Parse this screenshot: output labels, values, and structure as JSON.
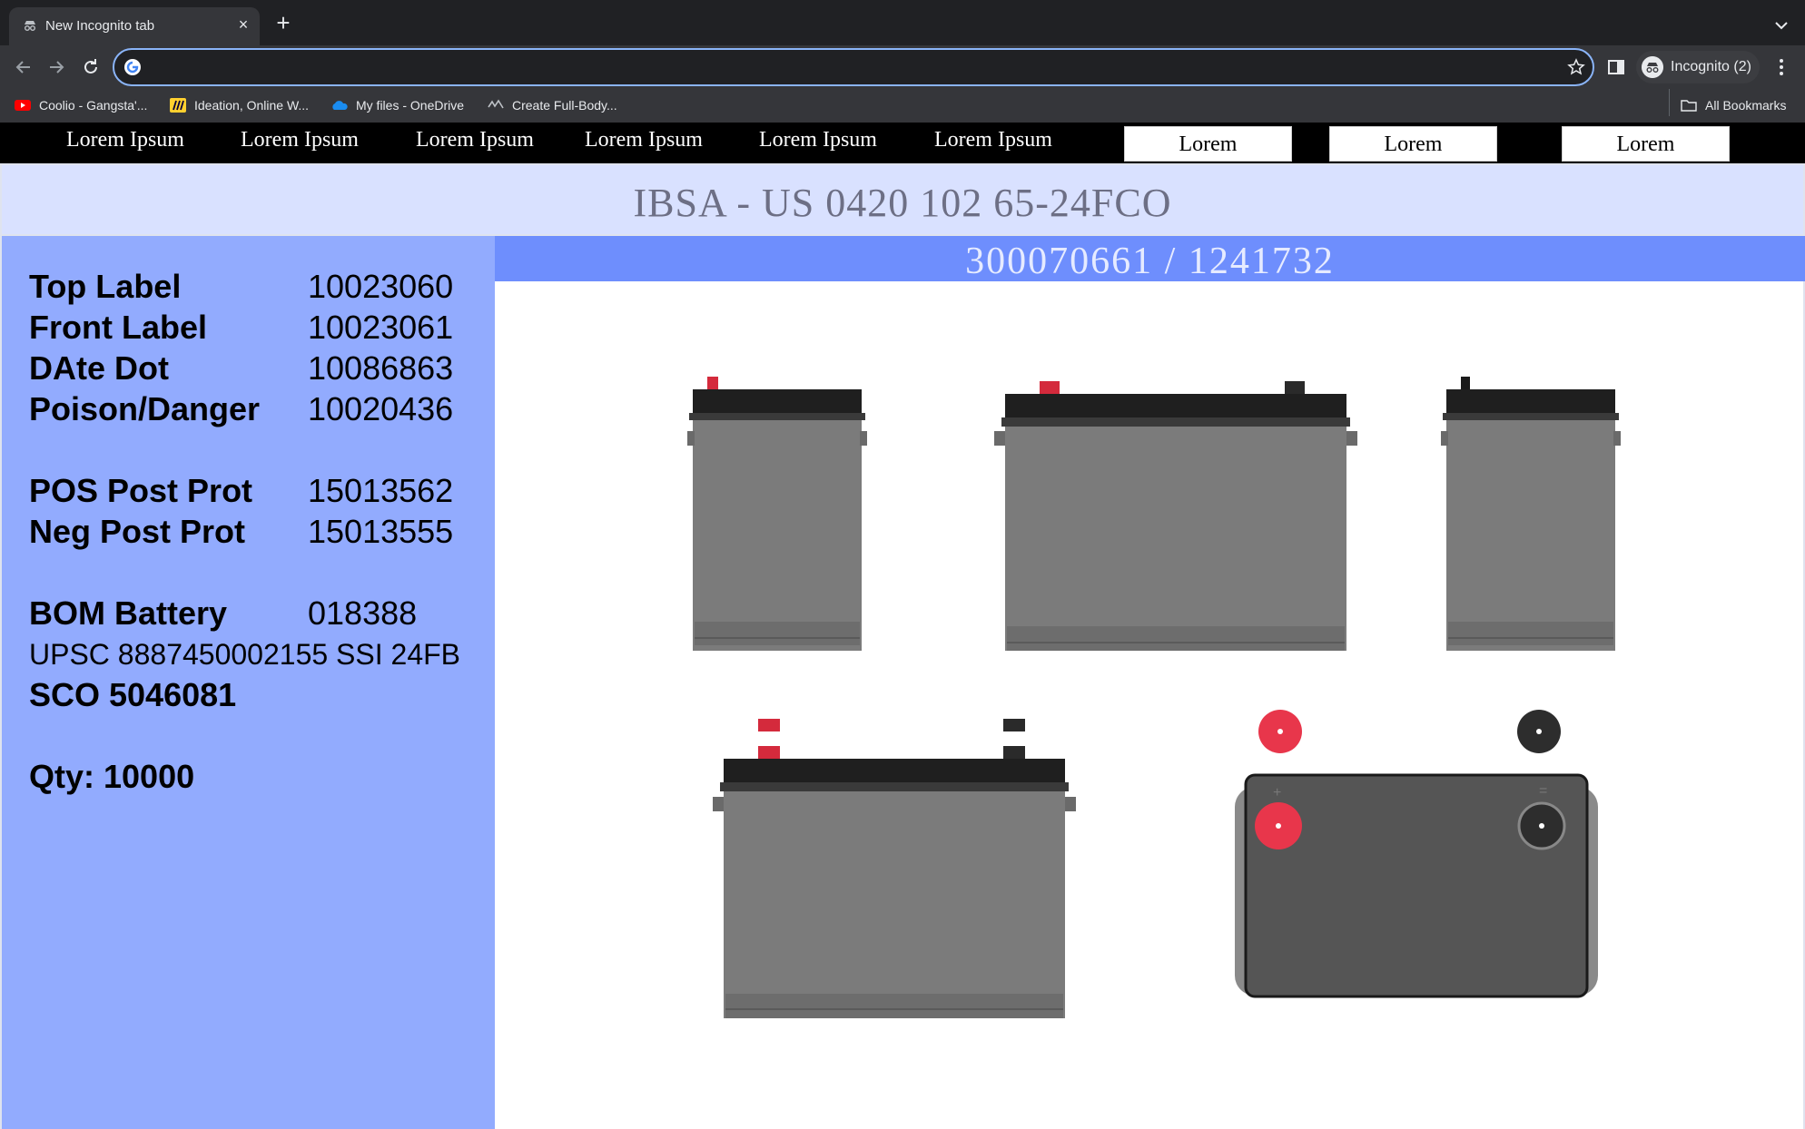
{
  "browser": {
    "tab_title": "New Incognito tab",
    "new_tab_symbol": "+",
    "close_symbol": "×",
    "address_value": "",
    "incognito_label": "Incognito (2)",
    "bookmarks": [
      {
        "label": "Coolio - Gangsta'...",
        "icon": "youtube-icon"
      },
      {
        "label": "Ideation, Online W...",
        "icon": "miro-icon"
      },
      {
        "label": "My files - OneDrive",
        "icon": "onedrive-icon"
      },
      {
        "label": "Create Full-Body...",
        "icon": "bookmark-site-icon"
      }
    ],
    "all_bookmarks_label": "All Bookmarks"
  },
  "nav": {
    "links": [
      "Lorem Ipsum",
      "Lorem Ipsum",
      "Lorem Ipsum",
      "Lorem Ipsum",
      "Lorem Ipsum",
      "Lorem Ipsum"
    ],
    "buttons": [
      "Lorem",
      "Lorem",
      "Lorem"
    ]
  },
  "header": {
    "title": "IBSA - US 0420 102 65-24FCO",
    "subtitle": "300070661 / 1241732"
  },
  "specs": {
    "labels": [
      {
        "label": "Top Label",
        "value": "10023060"
      },
      {
        "label": "Front Label",
        "value": "10023061"
      },
      {
        "label": "DAte Dot",
        "value": "10086863"
      },
      {
        "label": "Poison/Danger",
        "value": "10020436"
      }
    ],
    "posts": [
      {
        "label": "POS Post Prot",
        "value": "15013562"
      },
      {
        "label": "Neg Post Prot",
        "value": "15013555"
      }
    ],
    "bom": {
      "label": "BOM Battery",
      "value": "018388"
    },
    "upsc": "UPSC 8887450002155 SSI 24FB",
    "sco": "SCO 5046081",
    "qty": "Qty: 10000"
  },
  "colors": {
    "title_bg": "#d9e1ff",
    "panel_bg": "#92abfe",
    "subhead_bg": "#6e8efd",
    "nav_bg": "#000000",
    "battery_gray": "#7b7b7b",
    "battery_lid": "#1f1f1f",
    "terminal_pos": "#e8364b",
    "terminal_neg": "#2d2d2d"
  }
}
